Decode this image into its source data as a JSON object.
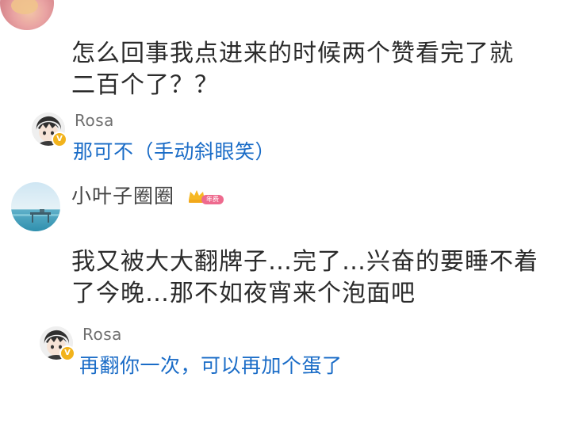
{
  "comments": [
    {
      "text_line1": "怎么回事我点进来的时候两个赞看完了就",
      "text_line2": "二百个了？？",
      "reply": {
        "username": "Rosa",
        "text": "那可不（手动斜眼笑）",
        "verified_badge": "V"
      }
    },
    {
      "username": "小叶子圈圈",
      "member_badge": "年费",
      "text_line1": "我又被大大翻牌子…完了…兴奋的要睡不着",
      "text_line2": "了今晚…那不如夜宵来个泡面吧",
      "reply": {
        "username": "Rosa",
        "text": "再翻你一次，可以再加个蛋了",
        "verified_badge": "V"
      }
    }
  ],
  "colors": {
    "reply_link": "#1a6cc7",
    "body_text": "#2b2b2b",
    "name_text": "#6f6f6f",
    "verified": "#f2b31c",
    "crown": "#f6b825",
    "badge_pink": "#ee6a8e"
  },
  "icons": {
    "verified": "verified-v-icon",
    "crown": "crown-icon"
  }
}
